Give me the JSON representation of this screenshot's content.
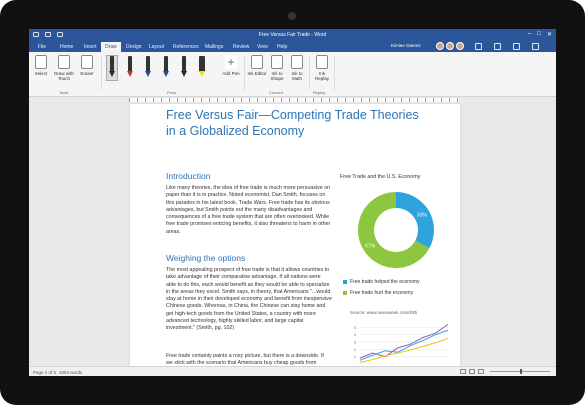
{
  "window": {
    "title": "Free Versus Fair Trade - Word",
    "user": "Kimiee Gaems"
  },
  "tabs": [
    "File",
    "Home",
    "Insert",
    "Draw",
    "Design",
    "Layout",
    "References",
    "Mailings",
    "Review",
    "View",
    "Help"
  ],
  "active_tab": "Draw",
  "ribbon": {
    "tools": [
      {
        "label": "Select",
        "icon": "select-icon"
      },
      {
        "label": "Draw with Touch",
        "icon": "touch-draw-icon"
      },
      {
        "label": "Eraser",
        "icon": "eraser-icon"
      }
    ],
    "pens": [
      {
        "icon": "pen-icon",
        "color": "#2b2b2b"
      },
      {
        "icon": "pen-icon",
        "color": "#c0392b"
      },
      {
        "icon": "pen-icon",
        "color": "#1f4e9c"
      },
      {
        "icon": "pen-icon",
        "color": "#1f4e9c"
      },
      {
        "icon": "pen-icon",
        "color": "#2b2b2b"
      },
      {
        "icon": "highlighter-icon",
        "color": "#f2e400"
      }
    ],
    "add_pen": "Add Pen",
    "convert": [
      {
        "label": "Ink Editor",
        "icon": "ink-editor-icon"
      },
      {
        "label": "Ink to Shape",
        "icon": "ink-to-shape-icon"
      },
      {
        "label": "Ink to Math",
        "icon": "ink-to-math-icon"
      }
    ],
    "replay": {
      "label": "Ink Replay",
      "icon": "ink-replay-icon"
    },
    "groups": {
      "tools": "Tools",
      "pens": "Pens",
      "convert": "Convert",
      "replay": "Replay"
    }
  },
  "document": {
    "title": "Free Versus Fair—Competing Trade Theories in a Globalized Economy",
    "h_intro": "Introduction",
    "intro": "Like many theories, the idea of free trade is much more persuasive on paper than it is in practice. Noted economist, Dan Smith, focuses on this paradox in his latest book, Trade Wars. Free trade has its obvious advantages, but Smith points out the many disadvantages and consequences of a free trade system that are often overlooked. While free trade promises enticing benefits, it also threatens to harm in other areas.",
    "h_options": "Weighing the options",
    "options": "The most appealing prospect of free trade is that it allows countries to take advantage of their comparative advantage. If all nations were able to do this, each would benefit as they would be able to specialize in the areas they excel. Smith says, in theory, that Americans \"...would stay at home in their developed economy and benefit from inexpensive Chinese goods. Whereas, in China, the Chinese can stay home and get high-tech goods from the United States, a country with more advanced technology, highly skilled labor, and large capital investment.\" (Smith, pg. 102)",
    "para3": "Free trade certainly paints a rosy picture, but there is a downside. If we stick with the scenario that Americans buy cheap goods from China, then there is a possibility that jobs will be lost as they move from one country to another. Advocates of free trade would say that although jobs are"
  },
  "chart_data": [
    {
      "type": "pie",
      "title": "Free Trade and the U.S. Economy",
      "categories": [
        "Free trade helped the economy",
        "Free trade hurt the economy"
      ],
      "values": [
        33,
        67
      ],
      "data_labels": [
        "33%",
        "67%"
      ],
      "colors": [
        "#2ea3dc",
        "#8dc63f"
      ],
      "donut": true
    },
    {
      "type": "line",
      "title": "",
      "source": "Source: www.newsweek.com/835",
      "x": [
        1,
        2,
        3,
        4,
        5,
        6,
        7,
        8
      ],
      "ylim": [
        0,
        6
      ],
      "yticks": [
        1,
        2,
        3,
        4,
        5
      ],
      "series": [
        {
          "values": [
            0.8,
            1.5,
            1.0,
            2.2,
            2.7,
            3.6,
            4.2,
            5.4
          ],
          "color": "#8e5bb5"
        },
        {
          "values": [
            0.5,
            1.2,
            1.8,
            1.6,
            2.5,
            3.2,
            4.0,
            4.6
          ],
          "color": "#2ea3dc"
        },
        {
          "values": [
            0.2,
            0.6,
            1.1,
            1.5,
            1.9,
            2.4,
            2.9,
            3.5
          ],
          "color": "#f2c400"
        }
      ]
    }
  ],
  "status": {
    "page": "Page 1 of 5",
    "words": "1084 words"
  }
}
